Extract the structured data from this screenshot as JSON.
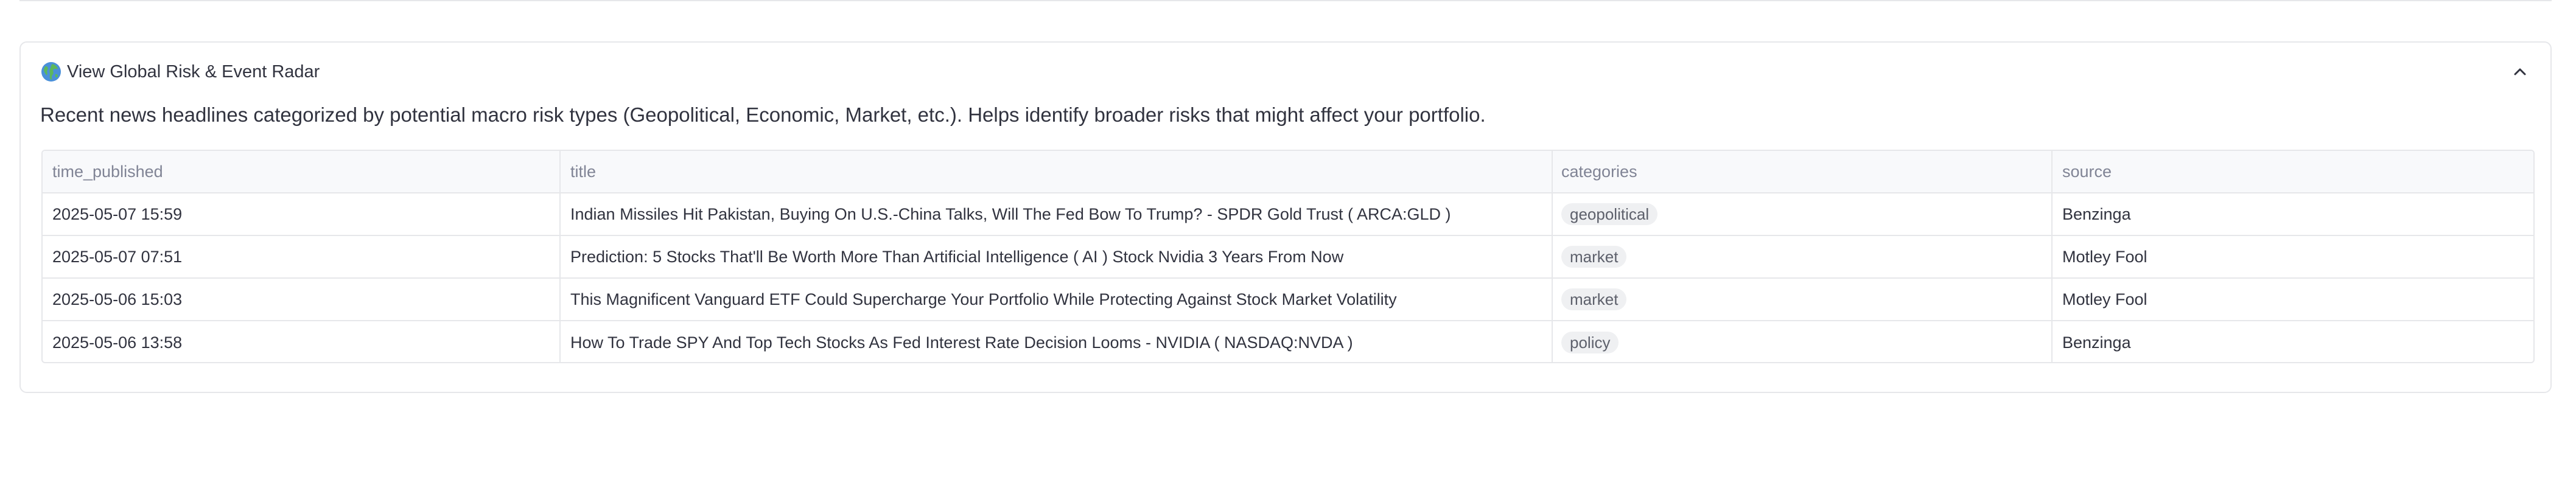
{
  "expander": {
    "icon": "globe-icon",
    "title": "View Global Risk & Event Radar",
    "description": "Recent news headlines categorized by potential macro risk types (Geopolitical, Economic, Market, etc.). Helps identify broader risks that might affect your portfolio.",
    "collapse_icon": "chevron-up-icon"
  },
  "table": {
    "columns": [
      "time_published",
      "title",
      "categories",
      "source"
    ],
    "rows": [
      {
        "time_published": "2025-05-07 15:59",
        "title": "Indian Missiles Hit Pakistan, Buying On U.S.-China Talks, Will The Fed Bow To Trump? - SPDR Gold Trust ( ARCA:GLD )",
        "categories": "geopolitical",
        "source": "Benzinga"
      },
      {
        "time_published": "2025-05-07 07:51",
        "title": "Prediction: 5 Stocks That'll Be Worth More Than Artificial Intelligence ( AI ) Stock Nvidia 3 Years From Now",
        "categories": "market",
        "source": "Motley Fool"
      },
      {
        "time_published": "2025-05-06 15:03",
        "title": "This Magnificent Vanguard ETF Could Supercharge Your Portfolio While Protecting Against Stock Market Volatility",
        "categories": "market",
        "source": "Motley Fool"
      },
      {
        "time_published": "2025-05-06 13:58",
        "title": "How To Trade SPY And Top Tech Stocks As Fed Interest Rate Decision Looms - NVIDIA ( NASDAQ:NVDA )",
        "categories": "policy",
        "source": "Benzinga"
      }
    ]
  }
}
